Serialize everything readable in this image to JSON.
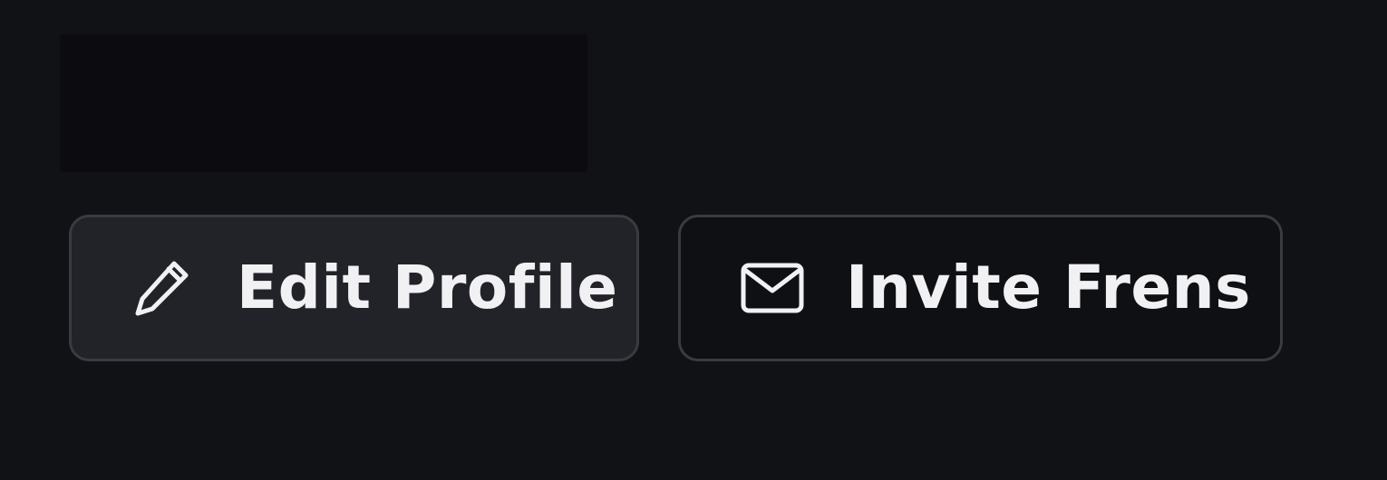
{
  "actions": {
    "edit_profile": {
      "label": "Edit Profile",
      "icon": "pencil-icon"
    },
    "invite_frens": {
      "label": "Invite Frens",
      "icon": "mail-icon"
    }
  },
  "colors": {
    "background": "#111216",
    "top_block": "#0c0c10",
    "edit_button_bg": "#222328",
    "invite_button_bg": "#0f1014",
    "border": "#3a3b40",
    "text": "#f1f1f3"
  }
}
